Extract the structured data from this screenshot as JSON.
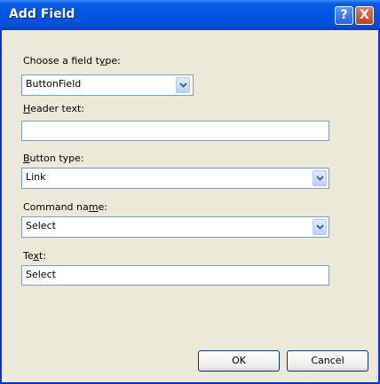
{
  "window": {
    "title": "Add Field"
  },
  "field_type": {
    "label": "Choose a field type:",
    "value": "ButtonField"
  },
  "header_text": {
    "label": "Header text:",
    "value": ""
  },
  "button_type": {
    "label": "Button type:",
    "value": "Link"
  },
  "command_name": {
    "label": "Command name:",
    "value": "Select"
  },
  "text": {
    "label": "Text:",
    "value": "Select"
  },
  "buttons": {
    "ok": "OK",
    "cancel": "Cancel"
  },
  "icons": {
    "help": "?",
    "close": "X"
  },
  "colors": {
    "titlebar": "#0054e3",
    "dialog_bg": "#ece9d8",
    "field_border": "#7f9db9"
  }
}
